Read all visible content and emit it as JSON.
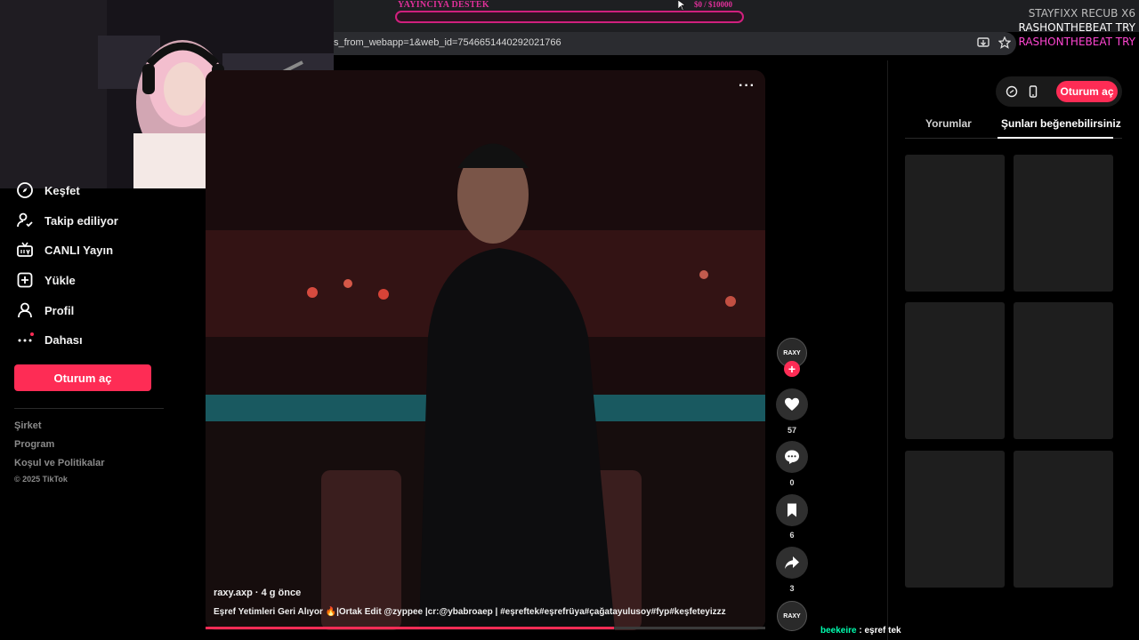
{
  "stream_overlay": {
    "donation_label": "YAYINCIYA DESTEK",
    "donation_amount": "$0  / $10000",
    "donation_progress": 0,
    "name_line1": "STAYFIXX  RECUB X6",
    "name_line2": "RASHONTHEBEAT  TRY",
    "name_line3": "RASHONTHEBEAT  TRY"
  },
  "browser": {
    "url": "s_from_webapp=1&web_id=7546651440292021766",
    "icons": [
      "install-app-icon",
      "bookmark-star-icon"
    ]
  },
  "sidebar": {
    "items": [
      {
        "label": "Keşfet",
        "icon": "compass-icon"
      },
      {
        "label": "Takip ediliyor",
        "icon": "following-icon"
      },
      {
        "label": "CANLI Yayın",
        "icon": "live-tv-icon"
      },
      {
        "label": "Yükle",
        "icon": "upload-icon"
      },
      {
        "label": "Profil",
        "icon": "profile-icon"
      },
      {
        "label": "Dahası",
        "icon": "more-icon"
      }
    ],
    "login_label": "Oturum aç",
    "footer_links": [
      "Şirket",
      "Program",
      "Koşul ve Politikalar"
    ],
    "copyright": "© 2025 TikTok"
  },
  "video": {
    "author_line": "raxy.axp · 4 g önce",
    "caption": "Eşref Yetimleri Geri Alıyor 🔥|Ortak Edit @zyppee |cr:@ybabroaep | #eşreftek#eşrefrüya#çağatayulusoy#fyp#keşfeteyizzz",
    "menu_label": "···",
    "progress": 0.73
  },
  "actions": {
    "avatar_text": "RAXY",
    "follow_label": "+",
    "likes": "57",
    "comments": "0",
    "saves": "6",
    "shares": "3"
  },
  "chat": {
    "user": "beekeire",
    "message": ": eşref tek"
  },
  "right_panel": {
    "login_label": "Oturum aç",
    "tabs": [
      "Yorumlar",
      "Şunları beğenebilirsiniz"
    ],
    "active_tab": "Şunları beğenebilirsiniz"
  },
  "colors": {
    "accent": "#fe2c55",
    "overlay_pink": "#e0309a",
    "chat_user": "#00ffb0"
  }
}
